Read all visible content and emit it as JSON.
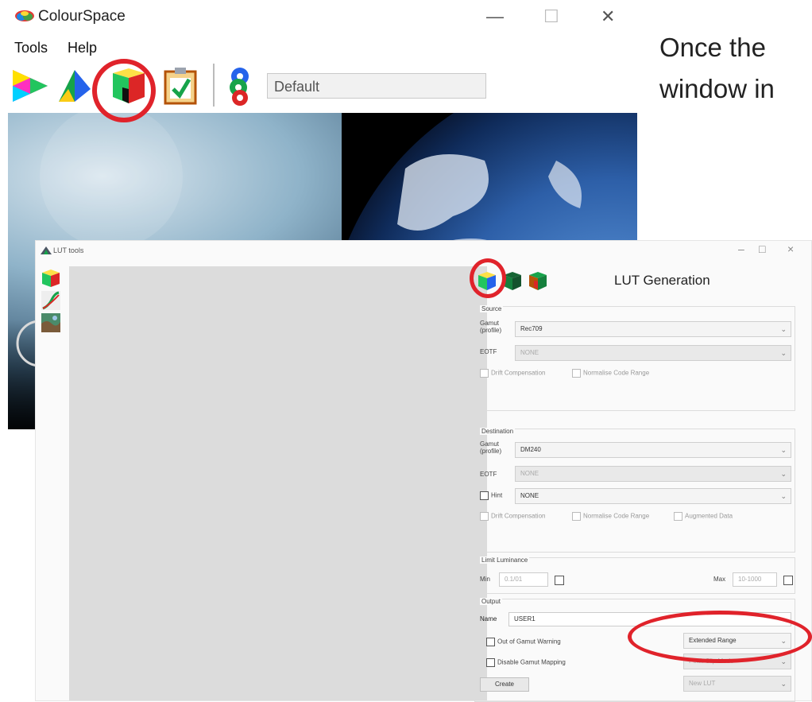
{
  "colourspace": {
    "app_title": "ColourSpace",
    "menu": [
      "Tools",
      "Help"
    ],
    "window_controls": {
      "minimize": "—",
      "maximize": "☐",
      "close": "✕"
    },
    "preset_field": "Default"
  },
  "slide": {
    "line1": "Once the",
    "line2": "window in"
  },
  "lut_tools": {
    "window_title": "LUT tools",
    "window_controls": {
      "minimize": "–",
      "maximize": "□",
      "close": "×"
    },
    "heading": "LUT Generation",
    "source": {
      "title": "Source",
      "gamut_label_1": "Gamut",
      "gamut_label_2": "(profile)",
      "gamut_value": "Rec709",
      "eotf_label": "EOTF",
      "eotf_value": "NONE",
      "drift_comp": "Drift Compensation",
      "normalise": "Normalise Code Range"
    },
    "destination": {
      "title": "Destination",
      "gamut_label_1": "Gamut",
      "gamut_label_2": "(profile)",
      "gamut_value": "DM240",
      "eotf_label": "EOTF",
      "eotf_value": "NONE",
      "hint_label": "Hint",
      "hint_value": "NONE",
      "drift_comp": "Drift Compensation",
      "normalise": "Normalise Code Range",
      "augmented": "Augmented Data"
    },
    "limit_luminance": {
      "title": "Limit Luminance",
      "min_label": "Min",
      "min_value": "0.1/01",
      "max_label": "Max",
      "max_value": "10-1000"
    },
    "output": {
      "title": "Output",
      "name_label": "Name",
      "name_value": "USER1",
      "out_of_gamut": "Out of Gamut Warning",
      "disable_mapping": "Disable Gamut Mapping",
      "range_value": "Extended Range",
      "peak_value": "Peak Clip Mode",
      "lut_value": "New LUT",
      "create_button": "Create"
    }
  },
  "colors": {
    "accent_red": "#e0232b"
  }
}
